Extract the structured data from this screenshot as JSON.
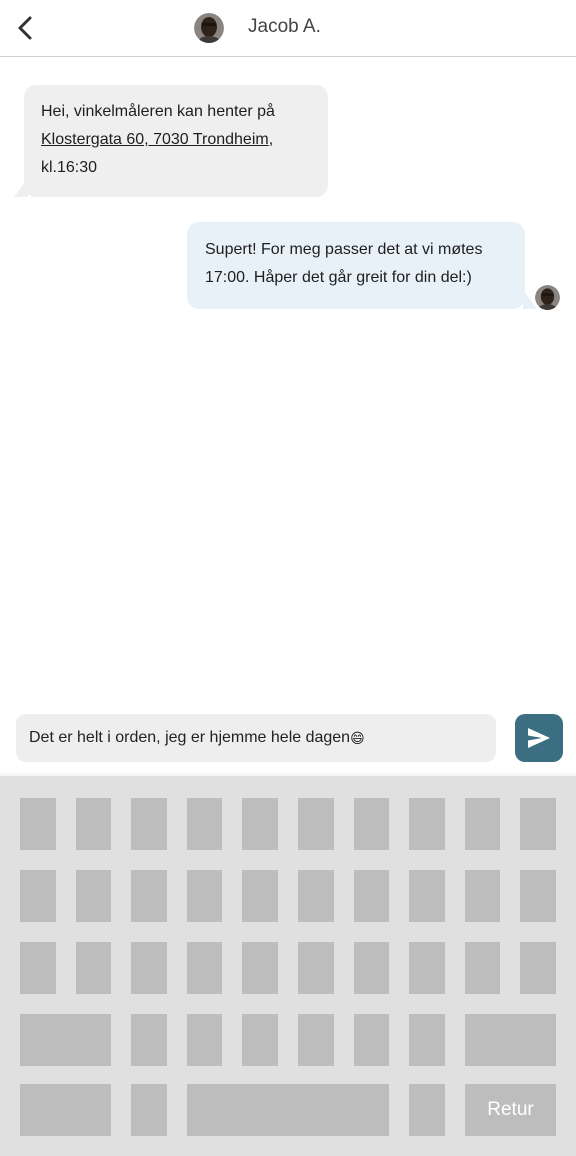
{
  "header": {
    "contact_name": "Jacob A.",
    "back_icon": "chevron-left-icon"
  },
  "messages": [
    {
      "direction": "incoming",
      "text_before": "Hei, vinkelmåleren kan henter på ",
      "link_text": "Klostergata 60, 7030 Trondheim",
      "text_after": ",",
      "line3": "kl.16:30"
    },
    {
      "direction": "outgoing",
      "line1": "Supert! For meg passer det at vi møtes",
      "line2": "17:00. Håper det går greit for din del:)"
    }
  ],
  "composer": {
    "draft_text": "Det er helt i orden, jeg er hjemme hele dagen",
    "draft_emoji": "😄",
    "send_icon": "send-icon"
  },
  "keyboard": {
    "return_label": "Retur"
  },
  "colors": {
    "incoming_bubble": "#efefef",
    "outgoing_bubble": "#e8f0f8",
    "send_button": "#3a6e80",
    "keyboard_bg": "#e0e0e0",
    "key": "#bdbdbd"
  }
}
